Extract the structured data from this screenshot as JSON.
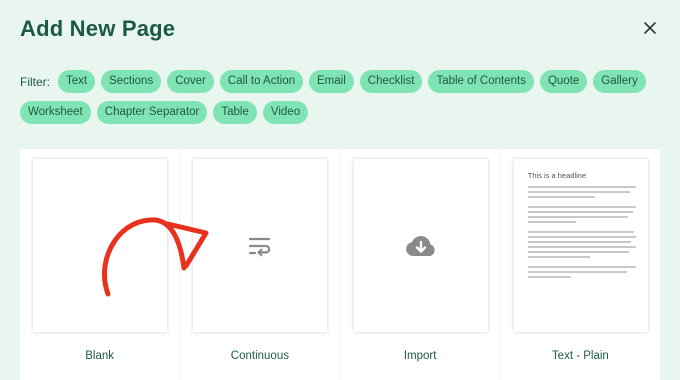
{
  "dialog": {
    "title": "Add New Page"
  },
  "filter": {
    "label": "Filter:",
    "chips": [
      "Text",
      "Sections",
      "Cover",
      "Call to Action",
      "Email",
      "Checklist",
      "Table of Contents",
      "Quote",
      "Gallery",
      "Worksheet",
      "Chapter Separator",
      "Table",
      "Video"
    ]
  },
  "templates": [
    {
      "label": "Blank"
    },
    {
      "label": "Continuous",
      "icon": "continuous-flow-icon"
    },
    {
      "label": "Import",
      "icon": "cloud-download-icon"
    },
    {
      "label": "Text - Plain",
      "preview_heading": "This is a headline"
    }
  ],
  "colors": {
    "background": "#e9f6ef",
    "chip": "#7fe3b3",
    "text": "#1d5a43",
    "arrow": "#e8321e"
  }
}
